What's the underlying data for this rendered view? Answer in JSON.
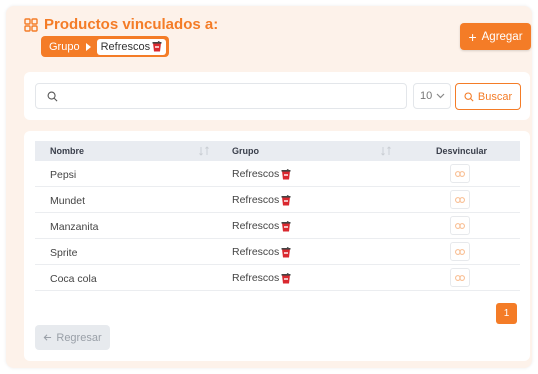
{
  "header": {
    "title": "Productos vinculados a:",
    "breadcrumb": {
      "group_label": "Grupo",
      "current_label": "Refrescos"
    },
    "add_button_label": "Agregar"
  },
  "search": {
    "placeholder": "",
    "page_size": "10",
    "search_button_label": "Buscar"
  },
  "table": {
    "columns": [
      "Nombre",
      "Grupo",
      "Desvincular"
    ],
    "rows": [
      {
        "name": "Pepsi",
        "group": "Refrescos"
      },
      {
        "name": "Mundet",
        "group": "Refrescos"
      },
      {
        "name": "Manzanita",
        "group": "Refrescos"
      },
      {
        "name": "Sprite",
        "group": "Refrescos"
      },
      {
        "name": "Coca cola",
        "group": "Refrescos"
      }
    ]
  },
  "pagination": {
    "current_page": "1"
  },
  "footer": {
    "back_button_label": "Regresar"
  },
  "colors": {
    "accent": "#f47c27",
    "background": "#fdf2ea",
    "header_row": "#e9ecf1"
  },
  "icons": [
    "grid-icon",
    "chevron-right-icon",
    "cup-icon",
    "plus-icon",
    "search-icon",
    "chevron-down-icon",
    "sort-icon",
    "link-icon",
    "arrow-left-icon"
  ]
}
